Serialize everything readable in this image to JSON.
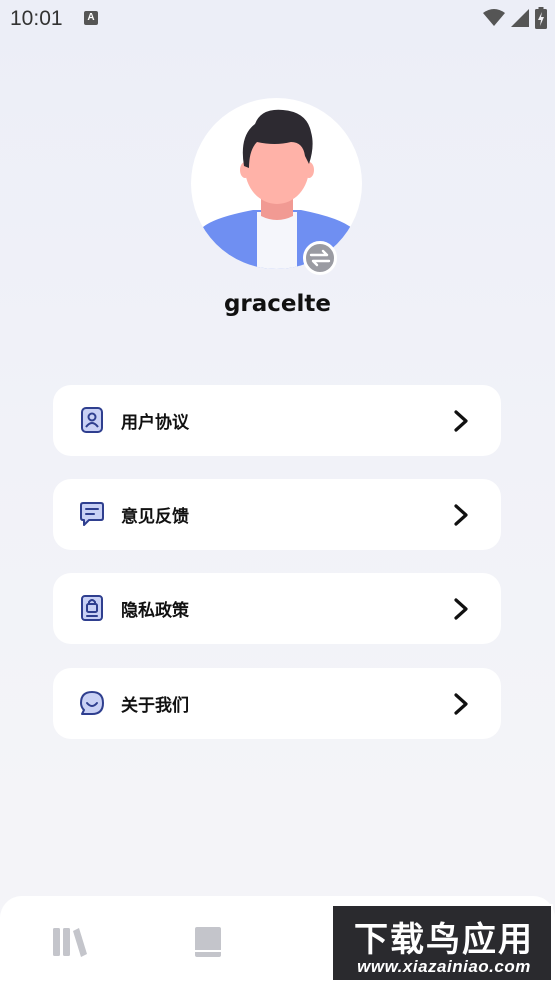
{
  "status_bar": {
    "time": "10:01",
    "notification_icon": "keyboard-a-icon",
    "notification_letter": "A",
    "icons": [
      "wifi-icon",
      "signal-icon",
      "battery-charging-icon"
    ]
  },
  "profile": {
    "username": "gracelte",
    "avatar_icon": "avatar-illustration",
    "switch_icon": "switch-account-icon"
  },
  "menu": {
    "items": [
      {
        "label": "用户协议",
        "icon": "user-agreement-icon"
      },
      {
        "label": "意见反馈",
        "icon": "feedback-icon"
      },
      {
        "label": "隐私政策",
        "icon": "privacy-lock-icon"
      },
      {
        "label": "关于我们",
        "icon": "about-chat-icon"
      }
    ]
  },
  "bottom_nav": {
    "items": [
      "bookshelf-icon",
      "book-icon",
      "profile-icon"
    ],
    "active_index": 2
  },
  "colors": {
    "accent": "#3a4fd6",
    "card_bg": "#ffffff",
    "page_bg": "#eef0f7"
  },
  "watermark": {
    "title": "下载鸟应用",
    "url": "www.xiazainiao.com"
  }
}
